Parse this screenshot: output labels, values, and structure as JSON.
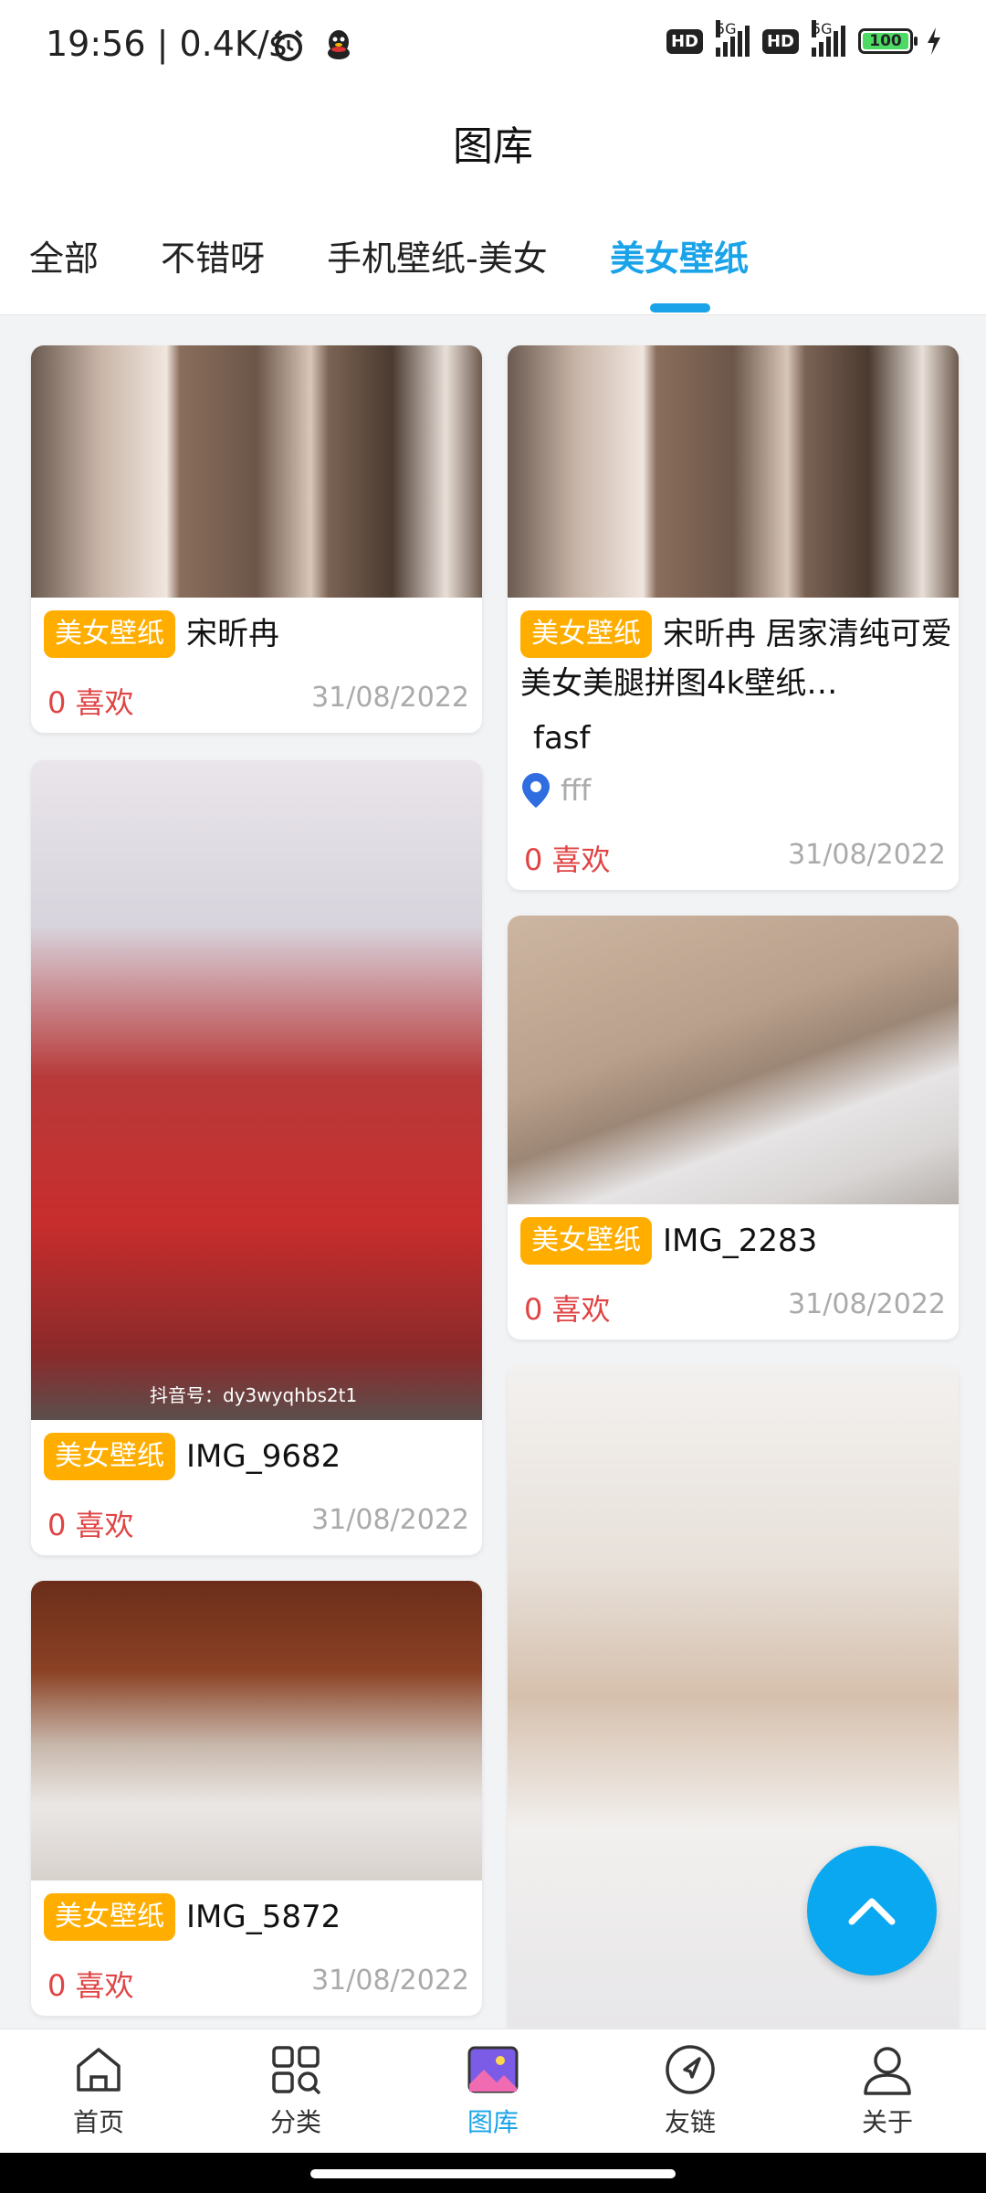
{
  "status": {
    "time": "19:56",
    "speed": "| 0.4K/s",
    "network": "5G",
    "battery": "100",
    "hd": "HD"
  },
  "header": {
    "title": "图库"
  },
  "tabs": [
    {
      "label": "全部"
    },
    {
      "label": "不错呀"
    },
    {
      "label": "手机壁纸-美女"
    },
    {
      "label": "美女壁纸"
    }
  ],
  "active_tab": "美女壁纸",
  "cards": [
    {
      "tag": "美女壁纸",
      "title": "宋昕冉",
      "likes": "0 喜欢",
      "date": "31/08/2022"
    },
    {
      "tag": "美女壁纸",
      "title": "宋昕冉 居家清纯可爱",
      "title_line2": "美女美腿拼图4k壁纸…",
      "desc": "fasf",
      "location": "fff",
      "likes": "0 喜欢",
      "date": "31/08/2022"
    },
    {
      "tag": "美女壁纸",
      "title": "IMG_9682",
      "likes": "0 喜欢",
      "date": "31/08/2022",
      "watermark": "抖音号：dy3wyqhbs2t1"
    },
    {
      "tag": "美女壁纸",
      "title": "IMG_2283",
      "likes": "0 喜欢",
      "date": "31/08/2022"
    },
    {
      "tag": "美女壁纸",
      "title": "IMG_5872",
      "likes": "0 喜欢",
      "date": "31/08/2022"
    }
  ],
  "bottom_nav": [
    {
      "label": "首页",
      "icon": "home-icon"
    },
    {
      "label": "分类",
      "icon": "category-icon"
    },
    {
      "label": "图库",
      "icon": "gallery-icon"
    },
    {
      "label": "友链",
      "icon": "link-icon"
    },
    {
      "label": "关于",
      "icon": "user-icon"
    }
  ],
  "colors": {
    "accent": "#1aa3e8",
    "tag": "#ffae00",
    "likes": "#e04444",
    "fab": "#0aa8f0"
  }
}
